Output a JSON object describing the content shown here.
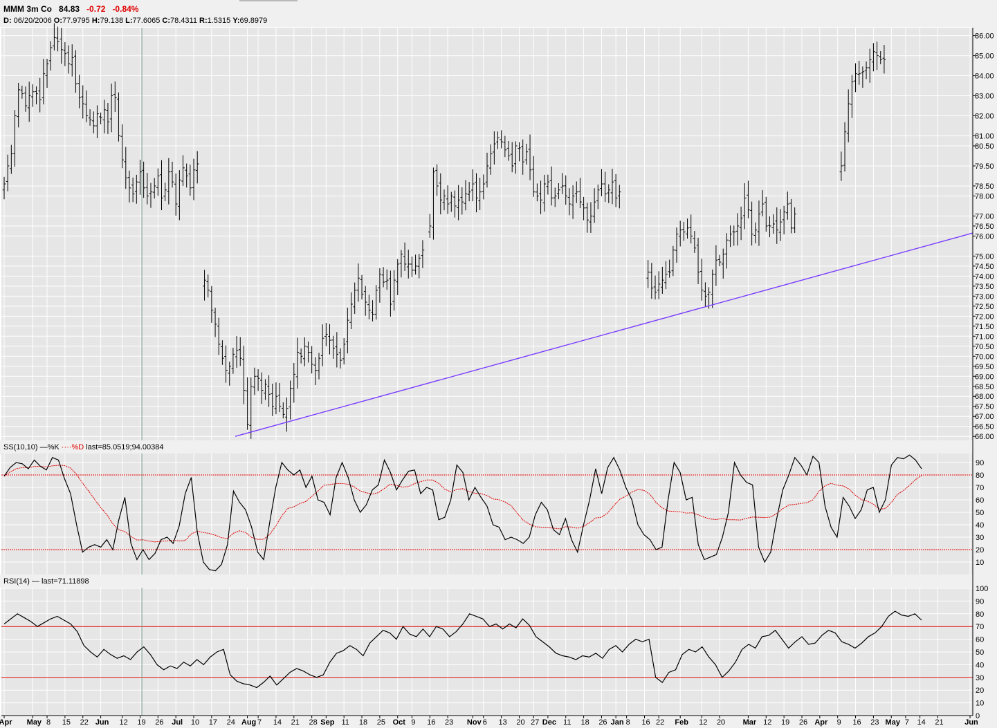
{
  "header": {
    "symbol": "MMM 3m Co",
    "last": "84.83",
    "change": "-0.72",
    "change_pct": "-0.84%",
    "ohlc_line": [
      {
        "k": "D:",
        "v": " 06/20/2006 "
      },
      {
        "k": "O:",
        "v": "77.9795 "
      },
      {
        "k": "H:",
        "v": "79.138 "
      },
      {
        "k": "L:",
        "v": "77.6065 "
      },
      {
        "k": "C:",
        "v": "78.4311 "
      },
      {
        "k": "R:",
        "v": "1.5315 "
      },
      {
        "k": "Y:",
        "v": "69.8979"
      }
    ]
  },
  "colors": {
    "panel_bg": "#e6e6e6",
    "grid": "#ffffff",
    "price": "#000000",
    "trendline": "#7a3cff",
    "ref_line": "#e00000",
    "cursor_line": "#7fa08f"
  },
  "chart_data": [
    {
      "type": "ohlc",
      "name": "price",
      "ylim": [
        65.8,
        86.4
      ],
      "yticks": [
        "86.00",
        "85.00",
        "84.00",
        "83.00",
        "82.00",
        "81.00",
        "80.50",
        "79.50",
        "78.50",
        "78.00",
        "77.00",
        "76.50",
        "76.00",
        "75.00",
        "74.50",
        "74.00",
        "73.50",
        "73.00",
        "72.50",
        "72.00",
        "71.50",
        "71.00",
        "70.50",
        "70.00",
        "69.50",
        "69.00",
        "68.50",
        "68.00",
        "67.50",
        "67.00",
        "66.50",
        "66.00"
      ],
      "trendline": {
        "from": [
          24,
          66.0
        ],
        "to": [
          270,
          76.15
        ]
      },
      "segments": [
        {
          "start": 0,
          "closes": [
            78.6,
            79.5,
            80.1,
            82.0,
            83.3,
            83.1,
            82.5,
            83.0,
            83.2,
            83.1,
            82.8,
            84.1,
            84.6,
            85.4,
            85.9,
            85.7,
            85.3,
            85.1,
            84.6,
            84.9,
            83.6,
            82.9,
            82.6,
            82.0,
            81.8,
            81.5,
            82.1,
            81.9,
            82.3,
            81.7,
            83.0,
            82.9,
            81.0,
            79.8,
            78.9,
            78.4,
            78.1,
            78.7,
            79.2,
            78.4,
            78.0,
            78.2,
            78.5,
            79.0,
            77.9,
            78.3,
            79.2,
            78.7,
            77.6,
            78.8,
            79.4,
            79.0,
            78.4,
            79.3,
            79.6
          ]
        },
        {
          "start": 56,
          "closes": [
            73.8,
            73.3,
            72.3,
            71.6,
            70.6,
            69.9,
            69.3,
            69.5,
            70.1,
            70.3,
            69.9,
            68.3,
            66.6,
            68.5,
            69.0,
            68.9,
            68.3,
            68.6,
            68.1,
            67.5,
            68.0,
            67.5,
            67.1,
            67.4,
            68.4,
            69.1,
            70.2,
            70.0,
            70.5,
            70.2,
            69.6,
            69.3,
            69.9,
            70.9,
            71.1,
            70.8,
            70.4,
            70.1,
            69.8,
            70.6,
            71.8,
            72.6,
            73.3,
            73.9,
            73.1,
            72.7,
            72.3,
            72.1,
            73.3,
            74.1,
            73.7,
            73.8,
            72.6,
            73.8,
            74.6,
            75.1,
            74.6,
            74.6,
            74.3,
            74.5,
            74.9,
            75.3
          ]
        },
        {
          "start": 119,
          "closes": [
            76.5,
            79.2,
            78.5,
            77.8,
            78.0,
            77.6,
            78.0,
            77.5,
            77.8,
            77.7,
            78.1,
            78.2,
            78.6,
            77.9,
            78.2,
            78.6,
            79.5,
            80.1,
            80.6,
            80.9,
            80.7,
            80.3,
            80.0,
            79.5,
            80.5,
            80.4,
            79.7,
            80.2,
            79.3,
            78.2,
            78.0,
            77.8,
            78.6,
            78.7,
            77.9,
            78.0,
            78.3,
            78.5,
            78.0,
            77.6,
            78.0,
            78.2,
            77.7,
            77.4,
            76.8,
            77.0,
            77.7,
            78.3,
            78.6,
            78.1,
            78.3,
            78.7,
            77.9,
            78.2
          ]
        },
        {
          "start": 180,
          "closes": [
            74.2,
            73.4,
            73.2,
            73.6,
            73.8,
            74.1,
            74.2,
            75.3,
            76.1,
            76.3,
            76.2,
            76.4,
            76.0,
            75.4,
            74.2,
            73.3,
            73.0,
            73.2,
            74.1,
            74.8,
            74.7,
            75.1,
            75.8,
            76.1,
            76.2,
            76.5,
            76.9,
            77.9,
            77.3,
            76.1,
            76.3,
            77.1,
            77.6,
            76.5,
            76.5,
            76.6,
            76.3,
            76.7,
            77.2,
            77.6,
            76.4,
            77.1
          ]
        },
        {
          "start": 234,
          "closes": [
            79.5,
            81.2,
            82.6,
            83.7,
            84.1,
            84.1,
            84.2,
            84.4,
            84.8,
            85.2,
            85.0,
            84.8,
            84.8
          ]
        }
      ]
    },
    {
      "type": "line",
      "name": "stochastic",
      "label": "SS(10,10)",
      "legend": [
        "%K",
        "%D"
      ],
      "last_text": "last=85.0519;94.00384",
      "ylim": [
        0,
        100
      ],
      "yticks": [
        "90",
        "80",
        "70",
        "60",
        "50",
        "40",
        "30",
        "20",
        "10"
      ],
      "ref_lines": [
        80,
        20
      ],
      "k": [
        79,
        86,
        90,
        89,
        85,
        92,
        87,
        84,
        94,
        92,
        77,
        65,
        40,
        18,
        22,
        24,
        22,
        28,
        20,
        44,
        62,
        25,
        12,
        20,
        12,
        17,
        28,
        30,
        25,
        39,
        65,
        78,
        34,
        10,
        4,
        3,
        8,
        24,
        67,
        58,
        52,
        38,
        18,
        12,
        42,
        70,
        90,
        84,
        80,
        84,
        70,
        79,
        60,
        58,
        48,
        78,
        90,
        78,
        60,
        50,
        56,
        68,
        72,
        92,
        82,
        68,
        76,
        83,
        84,
        65,
        70,
        68,
        44,
        46,
        60,
        88,
        82,
        60,
        70,
        62,
        55,
        40,
        38,
        28,
        30,
        28,
        25,
        30,
        48,
        58,
        52,
        36,
        32,
        45,
        28,
        18,
        40,
        60,
        85,
        65,
        86,
        94,
        84,
        70,
        60,
        40,
        32,
        28,
        20,
        22,
        60,
        90,
        82,
        60,
        62,
        24,
        12,
        14,
        16,
        30,
        50,
        90,
        80,
        74,
        72,
        22,
        10,
        18,
        45,
        68,
        80,
        94,
        88,
        80,
        95,
        90,
        55,
        38,
        30,
        62,
        55,
        45,
        52,
        68,
        70,
        50,
        60,
        88,
        94,
        93,
        96,
        92,
        85
      ]
    },
    {
      "type": "line",
      "name": "rsi",
      "label": "RSI(14)",
      "last_text": "last=71.11898",
      "ylim": [
        0,
        100
      ],
      "yticks": [
        "100",
        "90",
        "80",
        "70",
        "60",
        "50",
        "40",
        "30",
        "20",
        "10",
        "0"
      ],
      "ref_lines": [
        70,
        30
      ],
      "values": [
        72,
        76,
        80,
        77,
        74,
        70,
        73,
        76,
        78,
        75,
        72,
        66,
        55,
        50,
        46,
        52,
        48,
        45,
        47,
        44,
        50,
        54,
        48,
        40,
        36,
        39,
        37,
        42,
        39,
        44,
        40,
        46,
        50,
        52,
        32,
        27,
        25,
        24,
        22,
        26,
        31,
        24,
        29,
        34,
        37,
        35,
        32,
        30,
        32,
        42,
        49,
        51,
        55,
        52,
        47,
        57,
        62,
        67,
        65,
        60,
        70,
        64,
        62,
        68,
        62,
        70,
        68,
        62,
        66,
        72,
        80,
        78,
        76,
        70,
        72,
        68,
        72,
        69,
        76,
        71,
        62,
        58,
        54,
        49,
        47,
        46,
        44,
        47,
        46,
        49,
        45,
        52,
        55,
        50,
        56,
        60,
        58,
        60,
        30,
        26,
        34,
        36,
        48,
        52,
        50,
        54,
        46,
        40,
        30,
        35,
        42,
        52,
        56,
        53,
        62,
        63,
        67,
        60,
        53,
        58,
        62,
        56,
        57,
        63,
        67,
        65,
        58,
        56,
        53,
        57,
        62,
        65,
        70,
        78,
        82,
        79,
        78,
        80,
        75
      ]
    }
  ],
  "x_axis": {
    "labels": [
      {
        "t": "Apr",
        "i": 0,
        "b": true
      },
      {
        "t": "May",
        "i": 8,
        "b": true
      },
      {
        "t": "8",
        "i": 12
      },
      {
        "t": "15",
        "i": 17
      },
      {
        "t": "22",
        "i": 22
      },
      {
        "t": "Jun",
        "i": 27,
        "b": true
      },
      {
        "t": "12",
        "i": 33
      },
      {
        "t": "19",
        "i": 38
      },
      {
        "t": "26",
        "i": 43
      },
      {
        "t": "Jul",
        "i": 48,
        "b": true
      },
      {
        "t": "10",
        "i": 53
      },
      {
        "t": "17",
        "i": 58
      },
      {
        "t": "24",
        "i": 63
      },
      {
        "t": "Aug",
        "i": 68,
        "b": true
      },
      {
        "t": "7",
        "i": 71
      },
      {
        "t": "14",
        "i": 76
      },
      {
        "t": "21",
        "i": 81
      },
      {
        "t": "28",
        "i": 86
      },
      {
        "t": "Sep",
        "i": 90,
        "b": true
      },
      {
        "t": "11",
        "i": 95
      },
      {
        "t": "18",
        "i": 100
      },
      {
        "t": "25",
        "i": 105
      },
      {
        "t": "Oct",
        "i": 110,
        "b": true
      },
      {
        "t": "9",
        "i": 114
      },
      {
        "t": "16",
        "i": 119
      },
      {
        "t": "23",
        "i": 124
      },
      {
        "t": "Nov",
        "i": 131,
        "b": true
      },
      {
        "t": "6",
        "i": 134
      },
      {
        "t": "13",
        "i": 139
      },
      {
        "t": "20",
        "i": 144
      },
      {
        "t": "27",
        "i": 148
      },
      {
        "t": "Dec",
        "i": 152,
        "b": true
      },
      {
        "t": "11",
        "i": 157
      },
      {
        "t": "18",
        "i": 162
      },
      {
        "t": "26",
        "i": 167
      },
      {
        "t": "Jan",
        "i": 171,
        "b": true
      },
      {
        "t": "8",
        "i": 174
      },
      {
        "t": "16",
        "i": 179
      },
      {
        "t": "22",
        "i": 183
      },
      {
        "t": "Feb",
        "i": 189,
        "b": true
      },
      {
        "t": "12",
        "i": 195
      },
      {
        "t": "20",
        "i": 200
      },
      {
        "t": "Mar",
        "i": 208,
        "b": true
      },
      {
        "t": "12",
        "i": 213
      },
      {
        "t": "19",
        "i": 218
      },
      {
        "t": "26",
        "i": 223
      },
      {
        "t": "Apr",
        "i": 228,
        "b": true
      },
      {
        "t": "9",
        "i": 233
      },
      {
        "t": "16",
        "i": 238
      },
      {
        "t": "23",
        "i": 243
      },
      {
        "t": "May",
        "i": 248,
        "b": true
      },
      {
        "t": "7",
        "i": 252
      },
      {
        "t": "14",
        "i": 256
      },
      {
        "t": "21",
        "i": 261
      },
      {
        "t": "Jun",
        "i": 270,
        "b": true
      }
    ]
  }
}
